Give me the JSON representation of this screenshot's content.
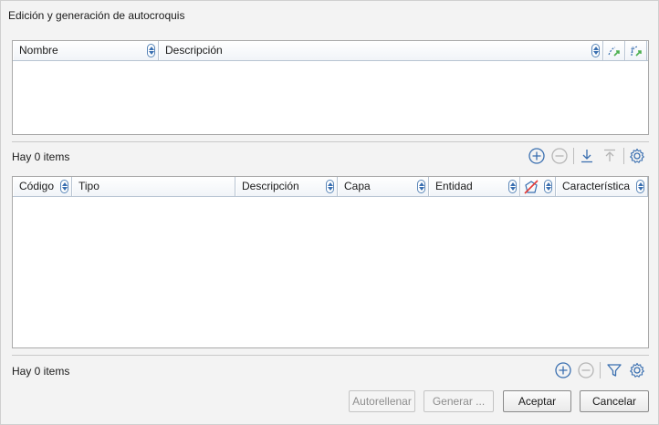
{
  "window": {
    "title": "Edición y generación de autocroquis"
  },
  "top_table": {
    "columns": [
      {
        "label": "Nombre"
      },
      {
        "label": "Descripción"
      }
    ],
    "icon_columns": [
      "link-map-icon",
      "formula-link-icon"
    ],
    "status": "Hay 0 items"
  },
  "top_toolbar": {
    "icons": [
      "add-icon",
      "remove-icon",
      "import-icon",
      "export-icon",
      "gear-icon"
    ]
  },
  "bottom_table": {
    "columns": [
      {
        "label": "Código"
      },
      {
        "label": "Tipo"
      },
      {
        "label": "Descripción"
      },
      {
        "label": "Capa"
      },
      {
        "label": "Entidad"
      },
      {
        "label": "Característica"
      }
    ],
    "icon_column": "no-shape-icon",
    "status": "Hay 0 items"
  },
  "bottom_toolbar": {
    "icons": [
      "add-icon",
      "remove-icon",
      "filter-icon",
      "gear-icon"
    ]
  },
  "buttons": {
    "autofill": "Autorellenar",
    "generate": "Generar ...",
    "accept": "Aceptar",
    "cancel": "Cancelar"
  },
  "colors": {
    "accent": "#3a6fb0",
    "border": "#a9a9a9",
    "header_border": "#b8c4d2"
  }
}
